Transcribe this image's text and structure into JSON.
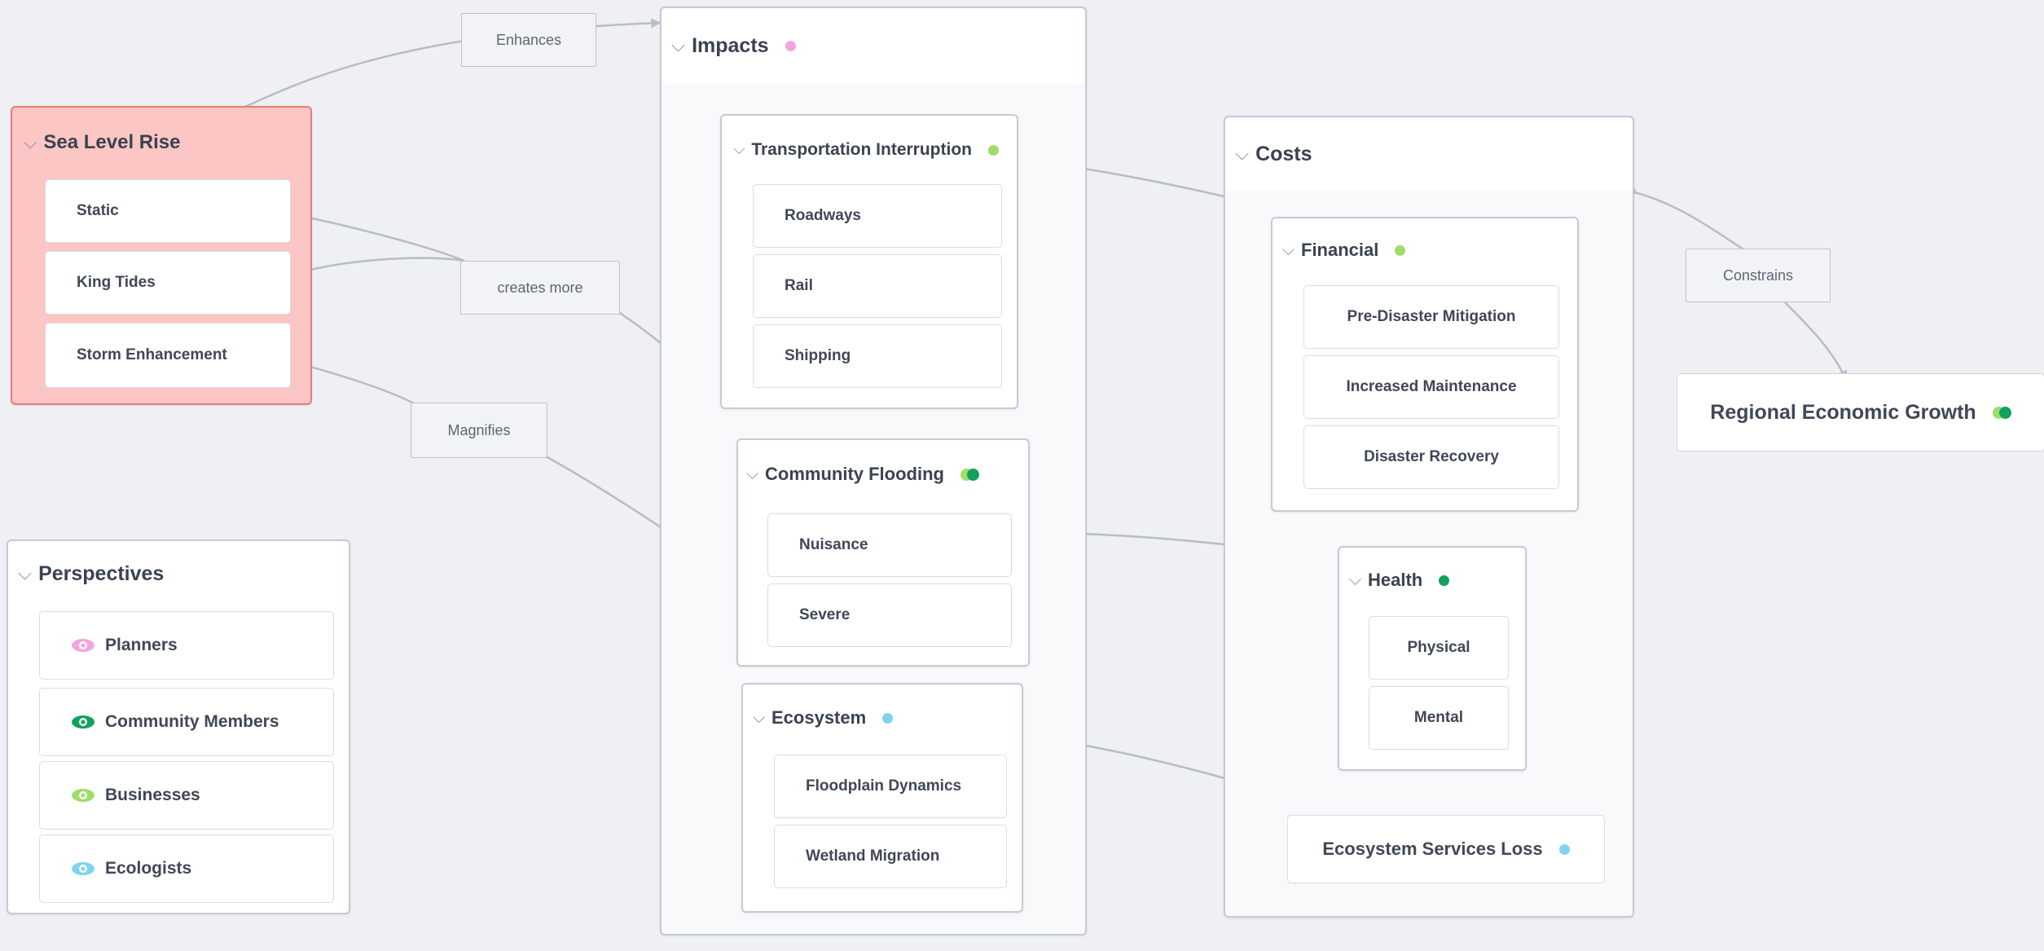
{
  "colors": {
    "planners": "#f3a6dc",
    "community_members": "#12a15c",
    "businesses": "#9fdc6a",
    "ecologists": "#7fd3ef",
    "edge": "#b7bcc7"
  },
  "groups": {
    "sea_level_rise": {
      "title": "Sea Level Rise",
      "items": [
        "Static",
        "King Tides",
        "Storm Enhancement"
      ]
    },
    "impacts": {
      "title": "Impacts"
    },
    "transportation": {
      "title": "Transportation Interruption",
      "items": [
        "Roadways",
        "Rail",
        "Shipping"
      ]
    },
    "community_flooding": {
      "title": "Community Flooding",
      "items": [
        "Nuisance",
        "Severe"
      ]
    },
    "ecosystem": {
      "title": "Ecosystem",
      "items": [
        "Floodplain Dynamics",
        "Wetland Migration"
      ]
    },
    "costs": {
      "title": "Costs"
    },
    "financial": {
      "title": "Financial",
      "items": [
        "Pre-Disaster Mitigation",
        "Increased Maintenance",
        "Disaster Recovery"
      ]
    },
    "health": {
      "title": "Health",
      "items": [
        "Physical",
        "Mental"
      ]
    },
    "perspectives": {
      "title": "Perspectives"
    }
  },
  "nodes": {
    "ecosystem_services_loss": "Ecosystem Services Loss",
    "regional_economic_growth": "Regional Economic Growth"
  },
  "perspectives": [
    {
      "label": "Planners",
      "color": "#f3a6dc"
    },
    {
      "label": "Community Members",
      "color": "#12a15c"
    },
    {
      "label": "Businesses",
      "color": "#9fdc6a"
    },
    {
      "label": "Ecologists",
      "color": "#7fd3ef"
    }
  ],
  "edge_labels": {
    "enhances": "Enhances",
    "creates_more": "creates more",
    "magnifies": "Magnifies",
    "constrains": "Constrains"
  }
}
